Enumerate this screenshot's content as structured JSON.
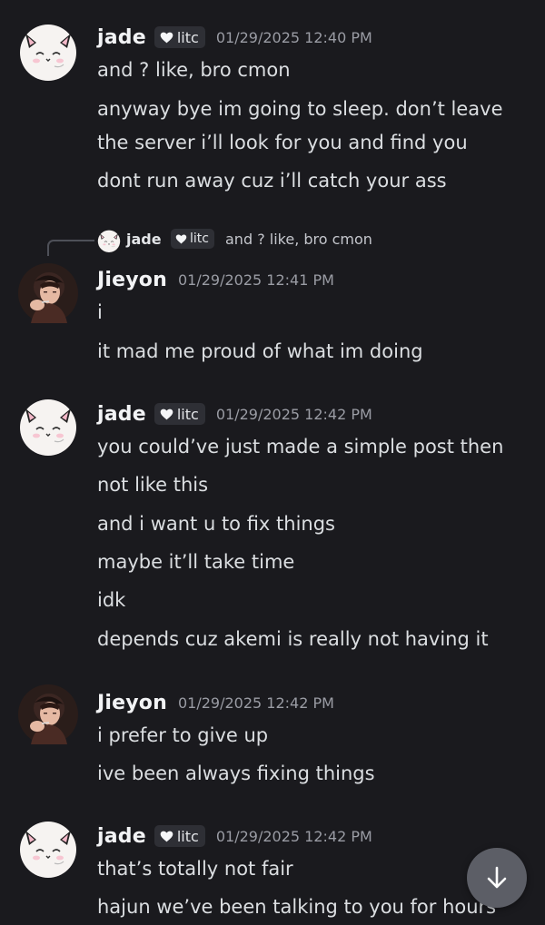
{
  "messages": [
    {
      "author": "jade",
      "tag": "litc",
      "timestamp": "01/29/2025 12:40 PM",
      "lines": [
        "and ? like, bro cmon",
        "anyway bye im going to sleep. don’t leave",
        "the server i’ll look for you and find you",
        "dont run away cuz i’ll catch your ass"
      ]
    },
    {
      "reply": {
        "author": "jade",
        "tag": "litc",
        "text": "and ? like, bro cmon"
      },
      "author": "Jieyon",
      "timestamp": "01/29/2025 12:41 PM",
      "lines": [
        "i",
        "it mad me proud of what im doing"
      ]
    },
    {
      "author": "jade",
      "tag": "litc",
      "timestamp": "01/29/2025 12:42 PM",
      "lines": [
        "you could’ve just made a simple post then",
        "not like this",
        "and i want u to fix things",
        "maybe it’ll take time",
        "idk",
        "depends cuz akemi is really not having it"
      ]
    },
    {
      "author": "Jieyon",
      "timestamp": "01/29/2025 12:42 PM",
      "lines": [
        "i prefer to give up",
        "ive been always fixing things"
      ]
    },
    {
      "author": "jade",
      "tag": "litc",
      "timestamp": "01/29/2025 12:42 PM",
      "lines": [
        "that’s totally not fair",
        "hajun we’ve been talking to you for hours"
      ]
    }
  ],
  "icons": {
    "tag_icon": "heart-icon",
    "jump_button_icon": "arrow-down-icon"
  },
  "colors": {
    "background": "#1a1a1e",
    "username": "#f2f3f5",
    "text": "#dbdee1",
    "timestamp": "#9a9ca4",
    "tag_bg": "#2e2f35",
    "jump_button": "#5c5e66"
  }
}
